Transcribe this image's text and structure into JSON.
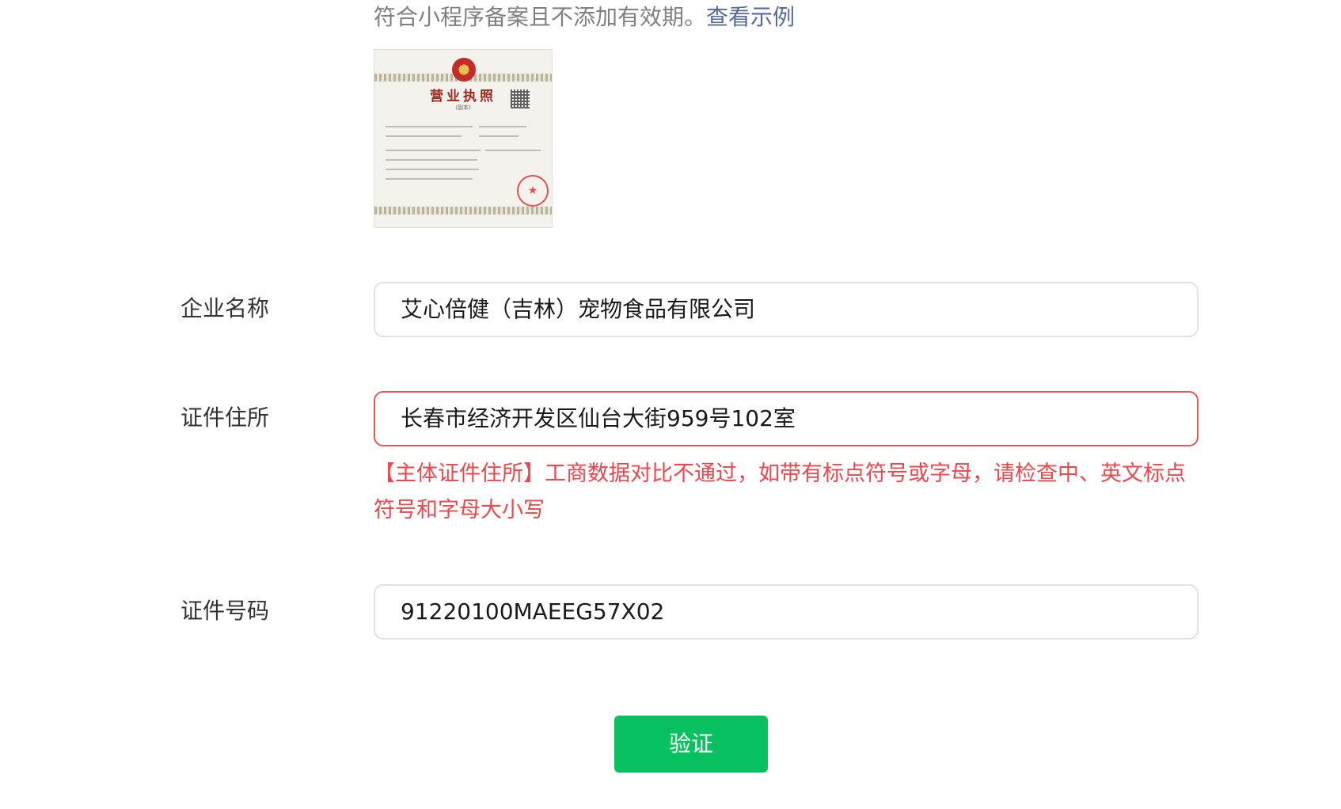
{
  "hint": {
    "text": "符合小程序备案且不添加有效期。",
    "example_link": "查看示例"
  },
  "license_image": {
    "title": "营业执照",
    "subtitle": "(副本)"
  },
  "form": {
    "company_name": {
      "label": "企业名称",
      "value": "艾心倍健（吉林）宠物食品有限公司"
    },
    "address": {
      "label": "证件住所",
      "value": "长春市经济开发区仙台大街959号102室",
      "error": "【主体证件住所】工商数据对比不通过，如带有标点符号或字母，请检查中、英文标点符号和字母大小写"
    },
    "license_number": {
      "label": "证件号码",
      "value": "91220100MAEEG57X02"
    }
  },
  "verify_button": {
    "label": "验证"
  },
  "colors": {
    "primary_green": "#07c160",
    "error_red": "#e9484e",
    "link_blue": "#576b95"
  }
}
